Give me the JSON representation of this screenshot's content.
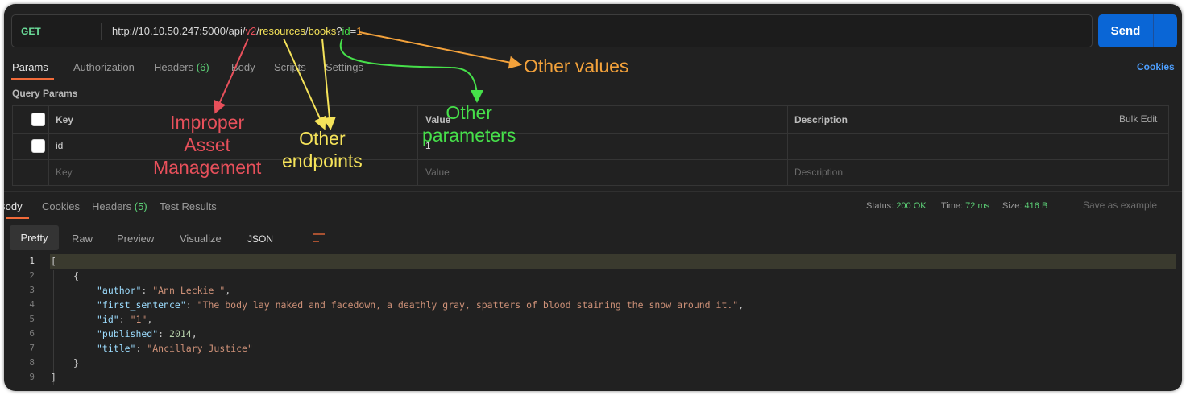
{
  "request": {
    "method": "GET",
    "url_parts": [
      {
        "text": "http://10.10.50.247:5000/api/",
        "hl": ""
      },
      {
        "text": "v2",
        "hl": "red"
      },
      {
        "text": "/",
        "hl": ""
      },
      {
        "text": "resources",
        "hl": "yel"
      },
      {
        "text": "/",
        "hl": ""
      },
      {
        "text": "books",
        "hl": "yel"
      },
      {
        "text": "?",
        "hl": ""
      },
      {
        "text": "id",
        "hl": "grn"
      },
      {
        "text": "=",
        "hl": ""
      },
      {
        "text": "1",
        "hl": "org"
      }
    ],
    "send_label": "Send"
  },
  "request_tabs": {
    "params": "Params",
    "authorization": "Authorization",
    "headers": "Headers",
    "headers_count": "(6)",
    "body": "Body",
    "scripts": "Scripts",
    "settings": "Settings",
    "cookies": "Cookies"
  },
  "query_params": {
    "title": "Query Params",
    "headers": {
      "key": "Key",
      "value": "Value",
      "description": "Description",
      "bulk_edit": "Bulk Edit"
    },
    "rows": [
      {
        "key": "id",
        "value": "1",
        "description": ""
      }
    ],
    "placeholder": {
      "key": "Key",
      "value": "Value",
      "description": "Description"
    }
  },
  "response_tabs": {
    "body": "Body",
    "cookies": "Cookies",
    "headers": "Headers",
    "headers_count": "(5)",
    "test_results": "Test Results"
  },
  "response_status": {
    "status_label": "Status:",
    "status_value": "200 OK",
    "time_label": "Time:",
    "time_value": "72 ms",
    "size_label": "Size:",
    "size_value": "416 B",
    "save_example": "Save as example"
  },
  "view_tabs": {
    "pretty": "Pretty",
    "raw": "Raw",
    "preview": "Preview",
    "visualize": "Visualize",
    "format": "JSON"
  },
  "response_body": {
    "line_numbers": [
      "1",
      "2",
      "3",
      "4",
      "5",
      "6",
      "7",
      "8",
      "9"
    ],
    "open_bracket": "[",
    "open_brace": "{",
    "close_brace": "}",
    "close_bracket": "]",
    "fields": [
      {
        "key": "\"author\"",
        "value": "\"Ann Leckie \"",
        "type": "string",
        "comma": ","
      },
      {
        "key": "\"first_sentence\"",
        "value": "\"The body lay naked and facedown, a deathly gray, spatters of blood staining the snow around it.\"",
        "type": "string",
        "comma": ","
      },
      {
        "key": "\"id\"",
        "value": "\"1\"",
        "type": "string",
        "comma": ","
      },
      {
        "key": "\"published\"",
        "value": "2014",
        "type": "number",
        "comma": ","
      },
      {
        "key": "\"title\"",
        "value": "\"Ancillary Justice\"",
        "type": "string",
        "comma": ""
      }
    ]
  },
  "annotations": {
    "improper_asset_management": "Improper\nAsset\nManagement",
    "other_endpoints": "Other\nendpoints",
    "other_parameters": "Other\nparameters",
    "other_values": "Other values"
  },
  "colors": {
    "red": "#e8505b",
    "yellow": "#f5e35a",
    "green": "#46e04a",
    "orange": "#f4a23b",
    "send_button": "#0a66d6",
    "active_tab_underline": "#f26b3a"
  }
}
